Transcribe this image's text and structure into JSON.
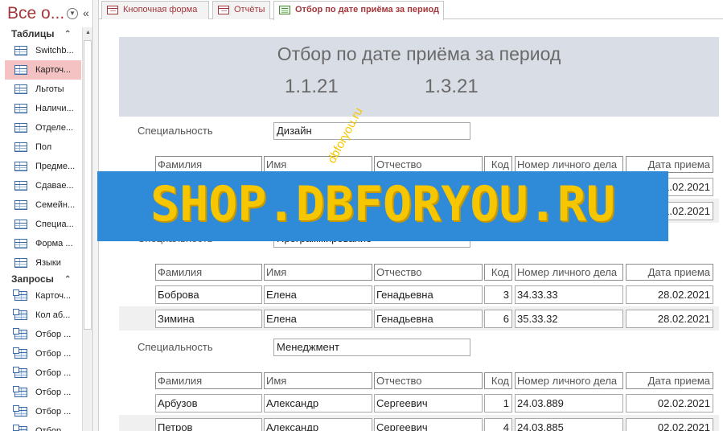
{
  "nav": {
    "title": "Все о...",
    "groups": [
      {
        "label": "Таблицы",
        "items": [
          "Switchb...",
          "Карточ...",
          "Льготы",
          "Наличи...",
          "Отделе...",
          "Пол",
          "Предме...",
          "Сдавае...",
          "Семейн...",
          "Специа...",
          "Форма ...",
          "Языки"
        ]
      },
      {
        "label": "Запросы",
        "items": [
          "Карточ...",
          "Кол аб...",
          "Отбор ...",
          "Отбор ...",
          "Отбор ...",
          "Отбор ...",
          "Отбор ...",
          "Отбор ..."
        ]
      }
    ],
    "selected": "Карточ..."
  },
  "tabs": [
    {
      "label": "Кнопочная форма",
      "icon": "form-icon",
      "active": false
    },
    {
      "label": "Отчёты",
      "icon": "form-icon",
      "active": false
    },
    {
      "label": "Отбор по дате приёма за период",
      "icon": "report-icon",
      "active": true
    }
  ],
  "report": {
    "title": "Отбор по дате приёма за период",
    "date_from": "1.1.21",
    "date_to": "1.3.21",
    "spec_label": "Специальность",
    "columns": [
      "Фамилия",
      "Имя",
      "Отчество",
      "Код",
      "Номер личного дела",
      "Дата приема"
    ],
    "groups": [
      {
        "specialty": "Дизайн",
        "rows": [
          [
            "",
            "",
            "",
            "",
            "",
            "1.02.2021"
          ],
          [
            "",
            "",
            "",
            "",
            "",
            "1.02.2021"
          ]
        ]
      },
      {
        "specialty": "Программирование",
        "rows": [
          [
            "Боброва",
            "Елена",
            "Генадьевна",
            "3",
            "34.33.33",
            "28.02.2021"
          ],
          [
            "Зимина",
            "Елена",
            "Генадьевна",
            "6",
            "35.33.32",
            "28.02.2021"
          ]
        ]
      },
      {
        "specialty": "Менеджмент",
        "rows": [
          [
            "Арбузов",
            "Александр",
            "Сергеевич",
            "1",
            "24.03.889",
            "02.02.2021"
          ],
          [
            "Петров",
            "Александр",
            "Сергеевич",
            "4",
            "24.03.885",
            "02.02.2021"
          ]
        ]
      }
    ]
  },
  "watermark": {
    "main": "SHOP.DBFORYOU.RU",
    "diagonal": "dbforyou.ru"
  },
  "colors": {
    "accent": "#a4373a",
    "header_band": "#d9dde6",
    "banner_bg": "#2f8bd8",
    "banner_text": "#f6c600"
  }
}
